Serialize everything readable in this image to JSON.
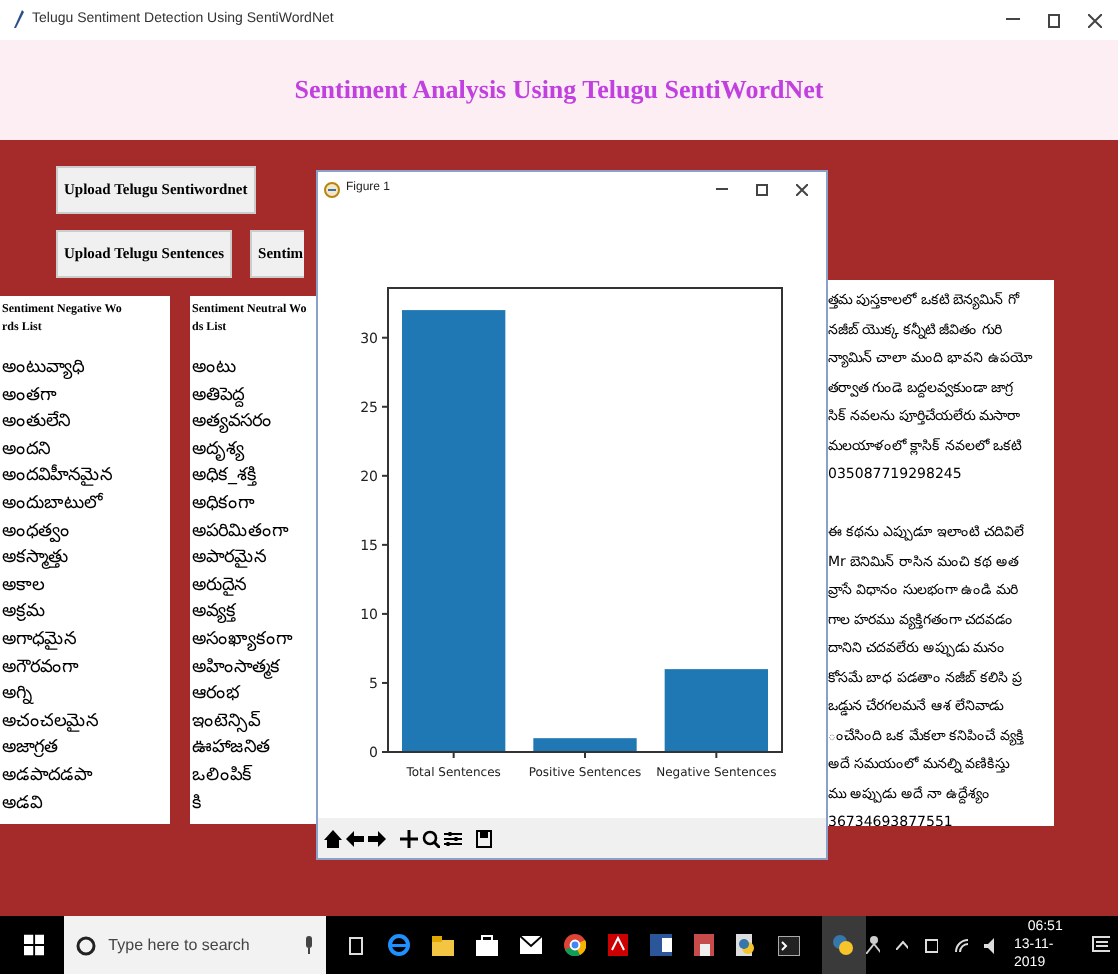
{
  "window": {
    "title": "Telugu Sentiment Detection Using SentiWordNet"
  },
  "header": {
    "title": "Sentiment Analysis Using Telugu SentiWordNet"
  },
  "button_rows": [
    [
      "Upload Telugu Sentiwordnet"
    ],
    [
      "Upload Telugu Sentences",
      "Sentim"
    ]
  ],
  "panels": [
    {
      "heading": [
        "Sentiment Negative Wo",
        "rds List"
      ],
      "words": [
        "అంటువ్యాధి",
        "అంతగా",
        "అంతులేని",
        "అందని",
        "అందవిహీనమైన",
        "అందుబాటులో",
        "అంధత్వం",
        "అకస్మాత్తు",
        "అకాల",
        "అక్రమ",
        "అగాధమైన",
        "అగౌరవంగా",
        "అగ్ని",
        "అచంచలమైన",
        "అజాగ్రత",
        "అడపాదడపా",
        "అడవి"
      ]
    },
    {
      "heading": [
        "Sentiment Neutral Wo",
        "ds List"
      ],
      "words": [
        "అంటు",
        "అతిపెద్ద",
        "అత్యవసరం",
        "అదృశ్య",
        "అధిక_శక్తి",
        "అధికంగా",
        "అపరిమితంగా",
        "అపారమైన",
        "అరుదైన",
        "అవ్యక్త",
        "అసంఖ్యాకంగా",
        "అహింసాత్మక",
        "ఆరంభ",
        "ఇంటెన్సివ్",
        "ఊహాజనిత",
        "ఒలింపిక్",
        "కి"
      ]
    }
  ],
  "review_panel": {
    "paragraphs": [
      [
        "త్తమ పుస్తకాలలో ఒకటి బెన్యమిన్ గో",
        "నజీబ్ యొక్క కన్నీటి జీవితం గురి",
        "న్యామిన్ చాలా మంది భావని ఉపయో",
        "తర్వాత గుండె బద్దలవ్వకుండా జాగ్ర",
        "సిక్ నవలను పూర్తిచేయలేరు మసారా",
        "మలయాళంలో క్లాసిక్ నవలలో ఒకటి",
        "035087719298245"
      ],
      [
        "ఈ కథను ఎప్పుడూ ఇలాంటి చదివిలే",
        "Mr బెనిమిన్ రాసిన మంచి కథ అత",
        "వ్రాసే విధానం సులభంగా ఉండి మరి",
        "గాల హరము వ్యక్తిగతంగా చదవడం",
        "దానిని చదవలేరు అప్పుడు మనం",
        "కోసమే బాధ పడతాం నజీబ్ కలిసి ప్ర",
        "ఒడ్డున చేరగలమనే ఆశ లేనివాడు",
        "ంచేసింది ఒక మేకలా కనిపించే వ్యక్తి",
        "అదే సమయంలో మనల్ని వణికిస్తు",
        "ము అప్పుడు అదే నా ఉద్దేశ్యం",
        "36734693877551"
      ]
    ]
  },
  "figure": {
    "title": "Figure 1",
    "chart_data": {
      "type": "bar",
      "categories": [
        "Total Sentences",
        "Positive Sentences",
        "Negative Sentences"
      ],
      "series": [
        {
          "color": "#1f77b4",
          "values": [
            32,
            1,
            6
          ]
        }
      ],
      "ylim": [
        0,
        33.6
      ],
      "yticks": [
        0,
        5,
        10,
        15,
        20,
        25,
        30
      ]
    }
  },
  "taskbar": {
    "search_placeholder": "Type here to search",
    "time": "06:51",
    "date": "13-11-2019"
  }
}
